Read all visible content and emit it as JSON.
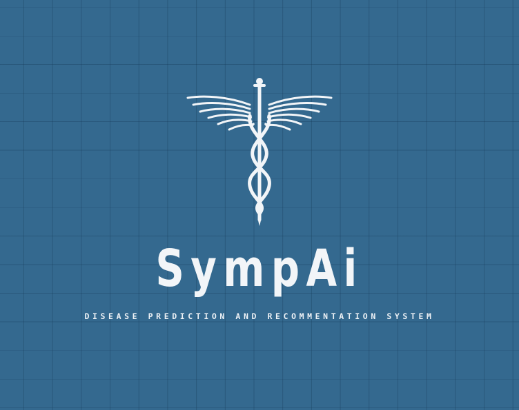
{
  "logo": {
    "icon": "caduceus-icon",
    "title": "SympAi",
    "tagline": "DISEASE PREDICTION AND RECOMMENTATION SYSTEM"
  },
  "colors": {
    "background": "#34698f",
    "grid_line": "#1f4868",
    "foreground": "#f2f5f8"
  }
}
